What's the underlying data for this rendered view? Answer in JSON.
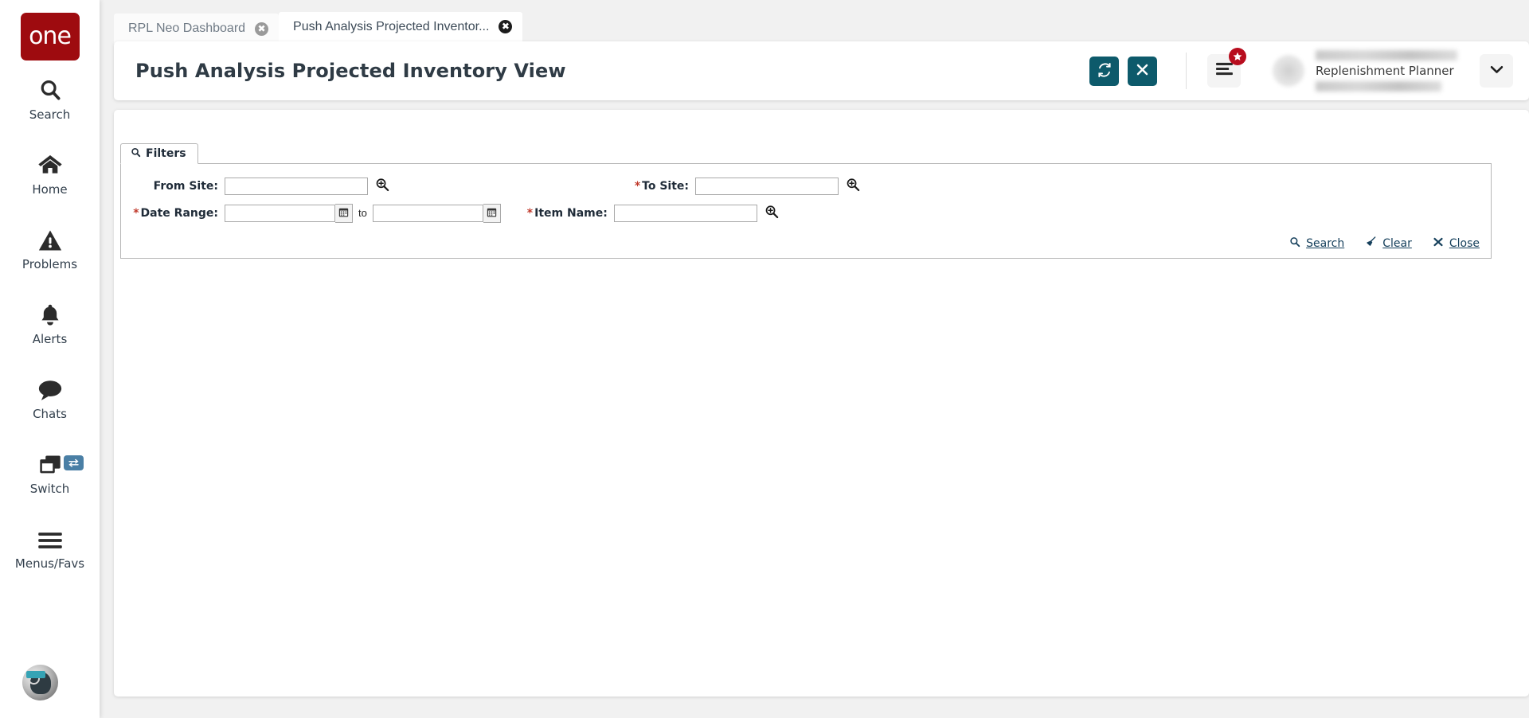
{
  "brand": {
    "logo_text": "one",
    "logo_color": "#9e0b0f"
  },
  "sidebar": {
    "items": [
      {
        "label": "Search",
        "icon": "search-icon"
      },
      {
        "label": "Home",
        "icon": "home-icon"
      },
      {
        "label": "Problems",
        "icon": "warning-triangle-icon"
      },
      {
        "label": "Alerts",
        "icon": "bell-icon"
      },
      {
        "label": "Chats",
        "icon": "chat-bubble-icon"
      },
      {
        "label": "Switch",
        "icon": "windows-stack-icon",
        "badge_icon": "swap-arrows-icon"
      },
      {
        "label": "Menus/Favs",
        "icon": "hamburger-icon"
      }
    ],
    "avatar_icon": "assistant-avatar-icon"
  },
  "tabs": [
    {
      "label": "RPL Neo Dashboard",
      "active": false,
      "close_icon": "close-circle-icon"
    },
    {
      "label": "Push Analysis Projected Inventor...",
      "active": true,
      "close_icon": "close-circle-icon"
    }
  ],
  "header": {
    "title": "Push Analysis Projected Inventory View",
    "accent_color": "#0d5a6b",
    "buttons": [
      {
        "name": "refresh-button",
        "icon": "refresh-icon"
      },
      {
        "name": "close-button",
        "icon": "x-icon"
      }
    ],
    "menu": {
      "icon": "hamburger-menu-icon",
      "badge_icon": "star-icon",
      "badge_color": "#b80d1e"
    },
    "user": {
      "name_redacted": "",
      "role": "Replenishment Planner",
      "detail_redacted": "",
      "dropdown_icon": "chevron-down-icon"
    }
  },
  "filters": {
    "tab_label": "Filters",
    "tab_icon": "search-icon",
    "fields": [
      {
        "label": "From Site:",
        "required": false,
        "value": "",
        "placeholder": "",
        "trailing_icon": "magnifier-plus-icon",
        "name": "from-site"
      },
      {
        "label": "To Site:",
        "required": true,
        "value": "",
        "placeholder": "",
        "trailing_icon": "magnifier-plus-icon",
        "name": "to-site"
      },
      {
        "label": "Date Range:",
        "required": true,
        "value": "",
        "value_to": "",
        "separator": "to",
        "trailing_icon": "calendar-icon",
        "name": "date-range"
      },
      {
        "label": "Item Name:",
        "required": true,
        "value": "",
        "placeholder": "",
        "trailing_icon": "magnifier-plus-icon",
        "name": "item-name"
      }
    ],
    "actions": [
      {
        "label": "Search",
        "icon": "search-icon",
        "name": "search-link"
      },
      {
        "label": "Clear",
        "icon": "broom-icon",
        "name": "clear-link"
      },
      {
        "label": "Close",
        "icon": "x-icon",
        "name": "close-link"
      }
    ]
  }
}
